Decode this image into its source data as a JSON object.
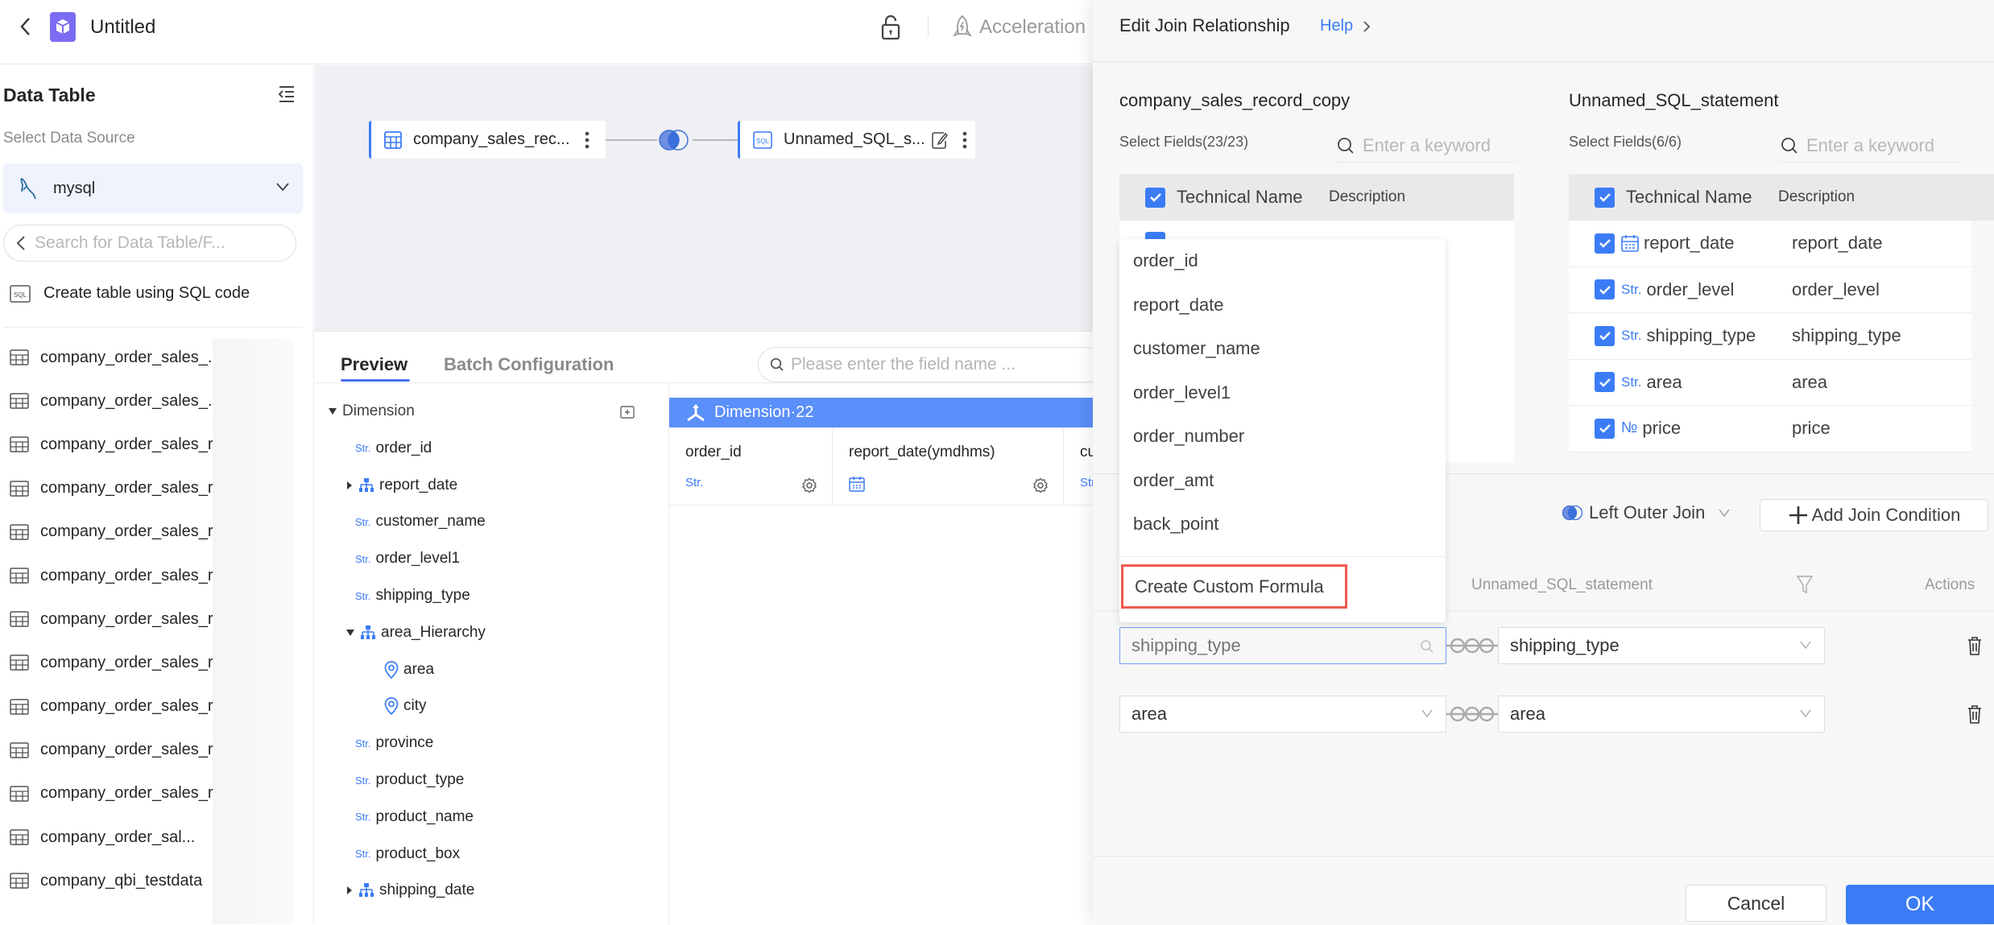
{
  "topbar": {
    "title": "Untitled",
    "acceleration_label": "Acceleration"
  },
  "sidebar": {
    "title": "Data Table",
    "select_source_label": "Select Data Source",
    "source_value": "mysql",
    "search_placeholder": "Search for Data Table/F...",
    "create_sql_label": "Create table using SQL code",
    "tables": [
      "company_order_sales_.",
      "company_order_sales_.",
      "company_order_sales_r",
      "company_order_sales_r",
      "company_order_sales_r",
      "company_order_sales_r",
      "company_order_sales_r",
      "company_order_sales_r",
      "company_order_sales_r",
      "company_order_sales_r",
      "company_order_sales_r",
      "company_order_sal...",
      "company_qbi_testdata"
    ]
  },
  "canvas": {
    "left_node": "company_sales_rec...",
    "right_node": "Unnamed_SQL_s..."
  },
  "bottom": {
    "tabs": [
      "Preview",
      "Batch Configuration"
    ],
    "active_tab": "Preview",
    "field_search_placeholder": "Please enter the field name ...",
    "tree": {
      "group_label": "Dimension",
      "items": [
        {
          "label": "order_id",
          "type": "Str."
        },
        {
          "label": "report_date",
          "type": "hierarchy",
          "expanded": false
        },
        {
          "label": "customer_name",
          "type": "Str."
        },
        {
          "label": "order_level1",
          "type": "Str."
        },
        {
          "label": "shipping_type",
          "type": "Str."
        },
        {
          "label": "area_Hierarchy",
          "type": "hierarchy",
          "expanded": true
        },
        {
          "label": "area",
          "type": "geo"
        },
        {
          "label": "city",
          "type": "geo"
        },
        {
          "label": "province",
          "type": "Str."
        },
        {
          "label": "product_type",
          "type": "Str."
        },
        {
          "label": "product_name",
          "type": "Str."
        },
        {
          "label": "product_box",
          "type": "Str."
        },
        {
          "label": "shipping_date",
          "type": "hierarchy",
          "expanded": false
        }
      ]
    },
    "dimension_header": "Dimension·22",
    "columns": [
      {
        "name": "order_id",
        "type": "Str."
      },
      {
        "name": "report_date(ymdhms)",
        "type": "date"
      },
      {
        "name": "cus",
        "type": "Str."
      }
    ]
  },
  "modal": {
    "title": "Edit Join Relationship",
    "help_label": "Help",
    "left_table": {
      "name": "company_sales_record_copy",
      "select_fields": "Select Fields(23/23)",
      "search_placeholder": "Enter a keyword",
      "header_technical": "Technical Name",
      "header_description": "Description"
    },
    "right_table": {
      "name": "Unnamed_SQL_statement",
      "select_fields": "Select Fields(6/6)",
      "search_placeholder": "Enter a keyword",
      "header_technical": "Technical Name",
      "header_description": "Description",
      "rows": [
        {
          "type": "date",
          "name": "report_date",
          "description": "report_date",
          "checked": true
        },
        {
          "type": "Str.",
          "name": "order_level",
          "description": "order_level",
          "checked": true
        },
        {
          "type": "Str.",
          "name": "shipping_type",
          "description": "shipping_type",
          "checked": true
        },
        {
          "type": "Str.",
          "name": "area",
          "description": "area",
          "checked": true
        },
        {
          "type": "№",
          "name": "price",
          "description": "price",
          "checked": true
        }
      ]
    },
    "join_type": "Left Outer Join",
    "add_condition_label": "Add Join Condition",
    "conditions_header": {
      "right_table": "Unnamed_SQL_statement",
      "actions": "Actions"
    },
    "conditions": [
      {
        "left_placeholder": "shipping_type",
        "left_value": "",
        "right_value": "shipping_type"
      },
      {
        "left_value": "area",
        "right_value": "area"
      }
    ],
    "cancel_label": "Cancel",
    "ok_label": "OK"
  },
  "dropdown": {
    "options": [
      "order_id",
      "report_date",
      "customer_name",
      "order_level1",
      "order_number",
      "order_amt",
      "back_point"
    ],
    "custom_formula_label": "Create Custom Formula",
    "highlight_color": "#ef5a4d"
  },
  "colors": {
    "accent": "#3b7cf6",
    "dimension_header": "#5b8ff9",
    "logo": "#7c6cf2"
  }
}
